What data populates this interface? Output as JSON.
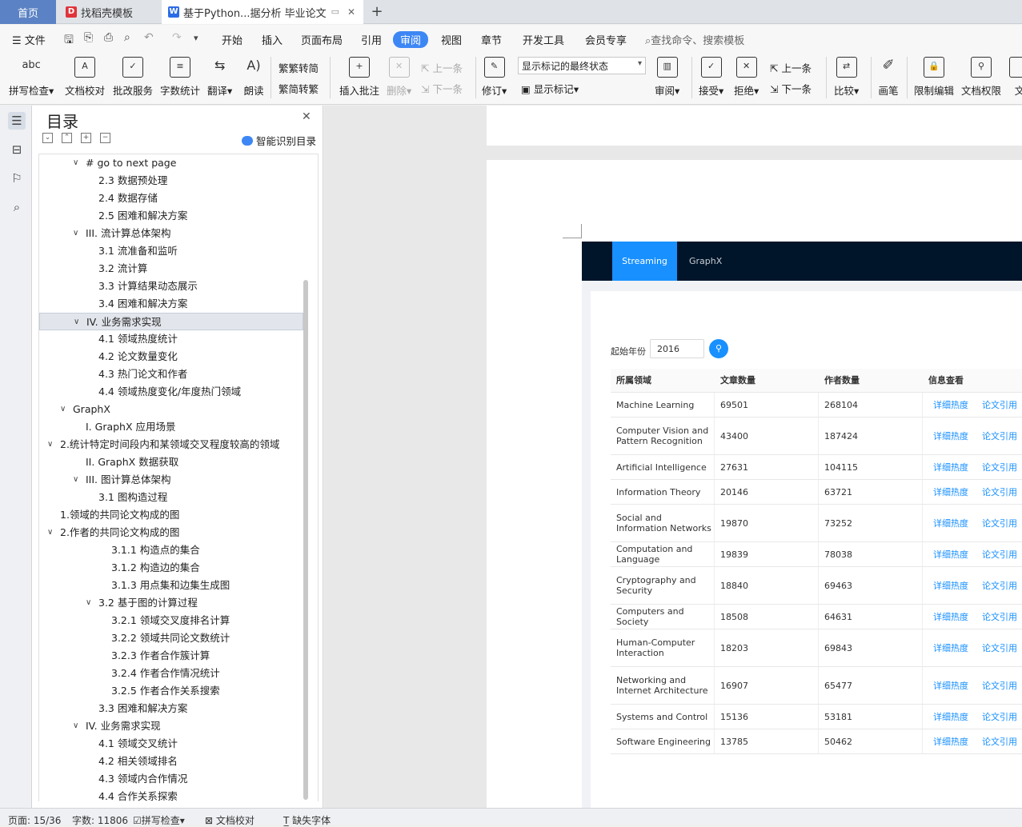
{
  "tabs": {
    "home": "首页",
    "template": "找稻壳模板",
    "doc": "基于Python...据分析 毕业论文",
    "new_tab": "+"
  },
  "menu": {
    "file": "文件",
    "items": [
      "开始",
      "插入",
      "页面布局",
      "引用",
      "审阅",
      "视图",
      "章节",
      "开发工具",
      "会员专享"
    ],
    "search": "查找命令、搜索模板"
  },
  "ribbon": {
    "spell_check": "拼写检查",
    "doc_check": "文档校对",
    "batch": "批改服务",
    "word_count": "字数统计",
    "translate": "翻译",
    "read": "朗读",
    "to_trad": "繁转简",
    "to_simp": "简转繁",
    "insert_comment": "插入批注",
    "delete": "删除",
    "prev": "上一条",
    "next": "下一条",
    "revise": "修订",
    "markup_state": "显示标记的最终状态",
    "show_markup": "显示标记",
    "review": "审阅",
    "accept": "接受",
    "reject": "拒绝",
    "prev2": "上一条",
    "next2": "下一条",
    "compare": "比较",
    "pen": "画笔",
    "restrict": "限制编辑",
    "permission": "文档权限",
    "more": "文"
  },
  "toc": {
    "title": "目录",
    "smart": "智能识别目录",
    "items": [
      {
        "text": "# go to next page",
        "caret": "down",
        "indent": 3
      },
      {
        "text": "2.3  数据预处理",
        "indent": 4
      },
      {
        "text": "2.4  数据存储",
        "indent": 4
      },
      {
        "text": "2.5  困难和解决方案",
        "indent": 4
      },
      {
        "text": "III. 流计算总体架构",
        "caret": "down",
        "indent": 3
      },
      {
        "text": "3.1  流准备和监听",
        "indent": 4
      },
      {
        "text": "3.2  流计算",
        "indent": 4
      },
      {
        "text": "3.3  计算结果动态展示",
        "indent": 4
      },
      {
        "text": "3.4  困难和解决方案",
        "indent": 4
      },
      {
        "text": "IV.  业务需求实现",
        "caret": "down",
        "indent": 3,
        "selected": true
      },
      {
        "text": "4.1  领域热度统计",
        "indent": 4
      },
      {
        "text": "4.2  论文数量变化",
        "indent": 4
      },
      {
        "text": "4.3  热门论文和作者",
        "indent": 4
      },
      {
        "text": "4.4  领域热度变化/年度热门领域",
        "indent": 4
      },
      {
        "text": "GraphX",
        "caret": "down",
        "indent": 2
      },
      {
        "text": "I. GraphX 应用场景",
        "indent": 3
      },
      {
        "text": "2.统计特定时间段内和某领域交叉程度较高的领域",
        "caret": "down",
        "indent": 1
      },
      {
        "text": "II. GraphX 数据获取",
        "indent": 3
      },
      {
        "text": "III. 图计算总体架构",
        "caret": "down",
        "indent": 3
      },
      {
        "text": "3.1  图构造过程",
        "indent": 4
      },
      {
        "text": "1.领域的共同论文构成的图",
        "indent": 1
      },
      {
        "text": "2.作者的共同论文构成的图",
        "caret": "down",
        "indent": 1
      },
      {
        "text": "3.1.1  构造点的集合",
        "indent": 5
      },
      {
        "text": "3.1.2  构造边的集合",
        "indent": 5
      },
      {
        "text": "3.1.3  用点集和边集生成图",
        "indent": 5
      },
      {
        "text": "3.2  基于图的计算过程",
        "caret": "down",
        "indent": 4
      },
      {
        "text": "3.2.1  领域交叉度排名计算",
        "indent": 5
      },
      {
        "text": "3.2.2  领域共同论文数统计",
        "indent": 5
      },
      {
        "text": "3.2.3  作者合作簇计算",
        "indent": 5
      },
      {
        "text": "3.2.4  作者合作情况统计",
        "indent": 5
      },
      {
        "text": "3.2.5  作者合作关系搜索",
        "indent": 5
      },
      {
        "text": "3.3  困难和解决方案",
        "indent": 4
      },
      {
        "text": "IV.  业务需求实现",
        "caret": "down",
        "indent": 3
      },
      {
        "text": "4.1  领域交叉统计",
        "indent": 4
      },
      {
        "text": "4.2  相关领域排名",
        "indent": 4
      },
      {
        "text": "4.3  领域内合作情况",
        "indent": 4
      },
      {
        "text": "4.4  合作关系探索",
        "indent": 4
      }
    ]
  },
  "webapp": {
    "nav": {
      "streaming": "Streaming",
      "graphx": "GraphX"
    },
    "start_year_label": "起始年份",
    "start_year": "2016",
    "headers": [
      "所属领域",
      "文章数量",
      "作者数量",
      "信息查看"
    ],
    "link_detail": "详细热度",
    "link_cite": "论文引用",
    "rows": [
      {
        "field": "Machine Learning",
        "papers": "69501",
        "authors": "268104"
      },
      {
        "field": "Computer Vision and Pattern Recognition",
        "papers": "43400",
        "authors": "187424"
      },
      {
        "field": "Artificial Intelligence",
        "papers": "27631",
        "authors": "104115"
      },
      {
        "field": "Information Theory",
        "papers": "20146",
        "authors": "63721"
      },
      {
        "field": "Social and Information Networks",
        "papers": "19870",
        "authors": "73252"
      },
      {
        "field": "Computation and Language",
        "papers": "19839",
        "authors": "78038"
      },
      {
        "field": "Cryptography and Security",
        "papers": "18840",
        "authors": "69463"
      },
      {
        "field": "Computers and Society",
        "papers": "18508",
        "authors": "64631"
      },
      {
        "field": "Human-Computer Interaction",
        "papers": "18203",
        "authors": "69843"
      },
      {
        "field": "Networking and Internet Architecture",
        "papers": "16907",
        "authors": "65477"
      },
      {
        "field": "Systems and Control",
        "papers": "15136",
        "authors": "53181"
      },
      {
        "field": "Software Engineering",
        "papers": "13785",
        "authors": "50462"
      }
    ]
  },
  "status": {
    "page": "页面: 15/36",
    "words": "字数: 11806",
    "spell": "拼写检查",
    "doccheck": "文档校对",
    "missing_font": "缺失字体"
  }
}
